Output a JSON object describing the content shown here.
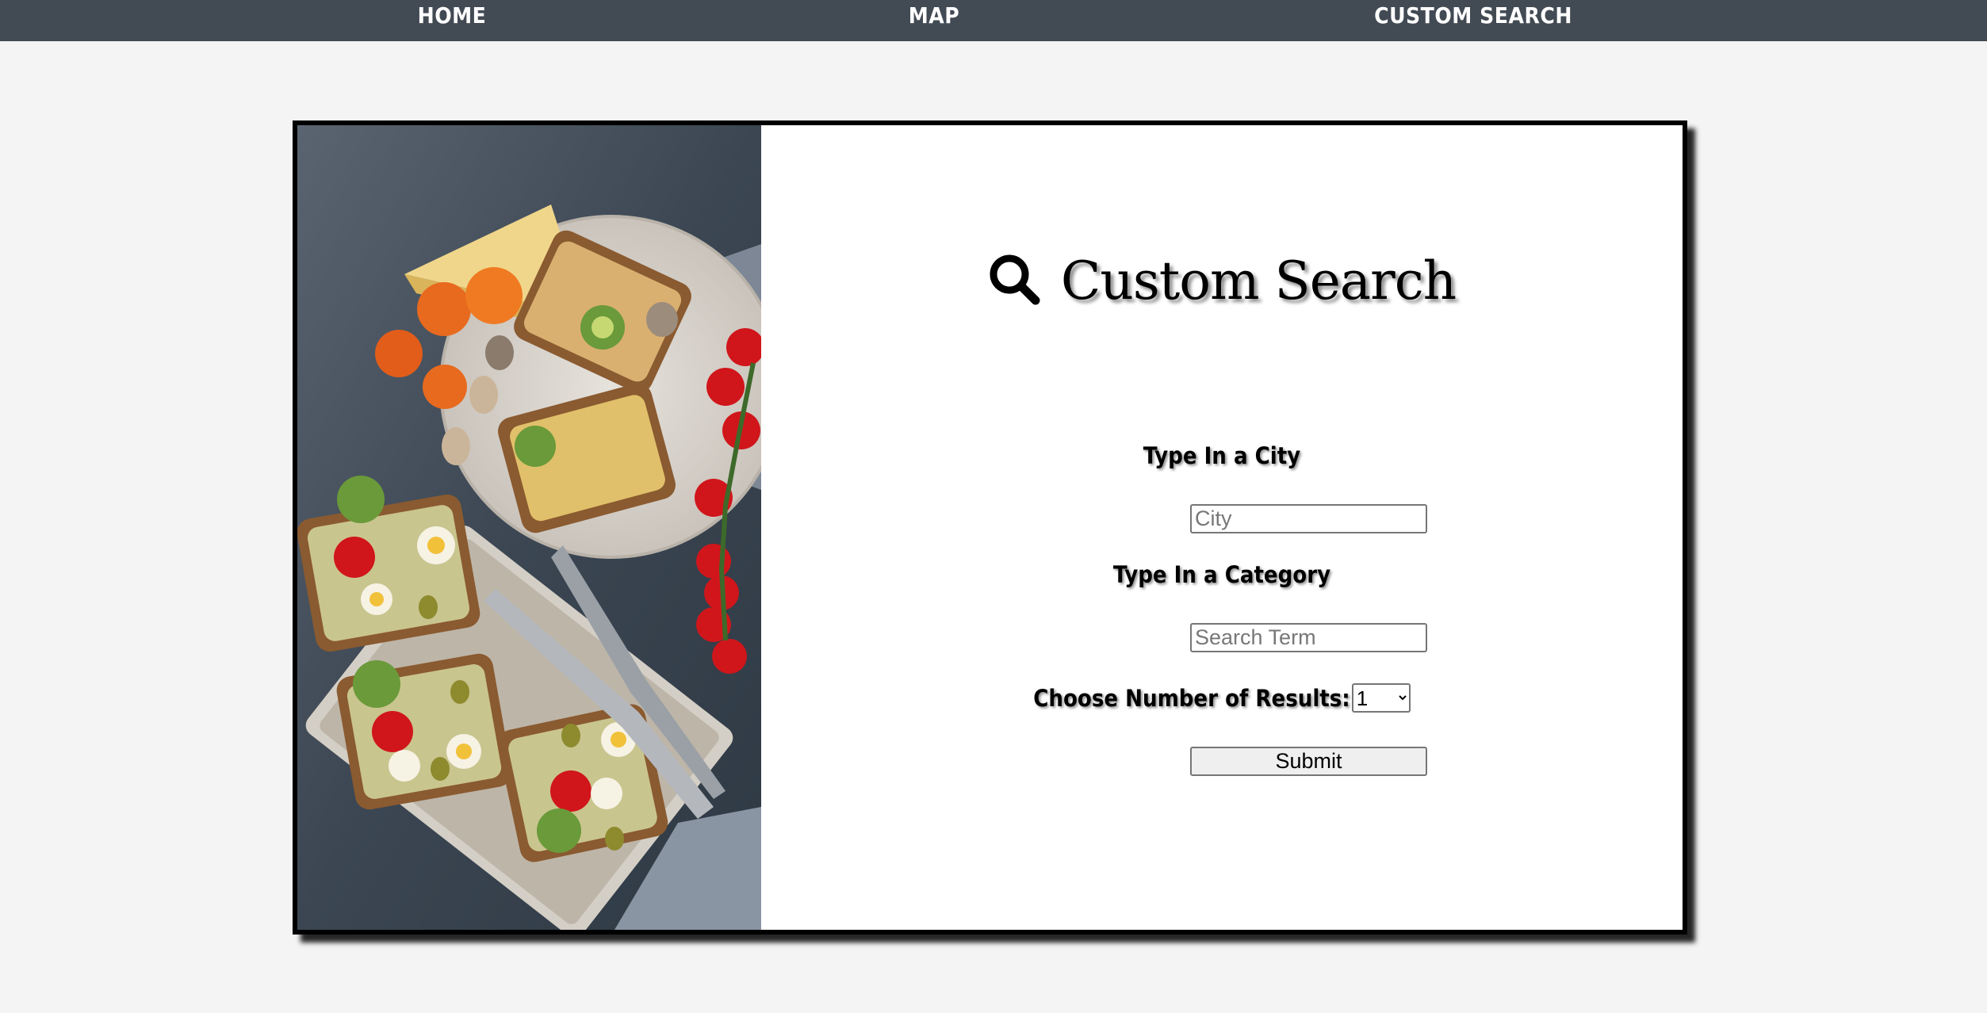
{
  "nav": {
    "home": "HOME",
    "map": "MAP",
    "custom_search": "CUSTOM SEARCH"
  },
  "colors": {
    "nav_bg": "#424a54",
    "page_bg": "#f4f4f4",
    "card_border": "#000000"
  },
  "hero_image": {
    "icon": "food-photo-bruschetta"
  },
  "form": {
    "title": "Custom Search",
    "title_icon": "search-icon",
    "city_label": "Type In a City",
    "city_placeholder": "City",
    "city_value": "",
    "category_label": "Type In a Category",
    "category_placeholder": "Search Term",
    "category_value": "",
    "results_label": "Choose Number of Results:",
    "results_selected": "1",
    "submit_label": "Submit"
  }
}
